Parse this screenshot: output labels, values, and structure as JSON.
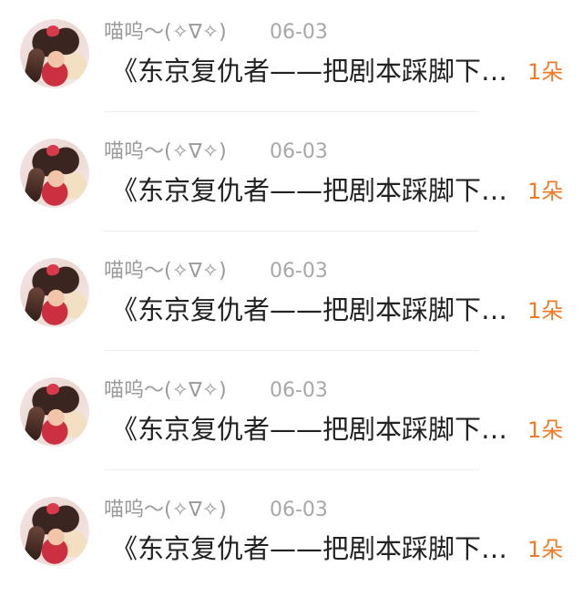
{
  "items": [
    {
      "author": "喵呜～(✧∇✧)",
      "date": "06-03",
      "title": "《东京复仇者——把剧本踩脚下…",
      "count": "1朵"
    },
    {
      "author": "喵呜～(✧∇✧)",
      "date": "06-03",
      "title": "《东京复仇者——把剧本踩脚下…",
      "count": "1朵"
    },
    {
      "author": "喵呜～(✧∇✧)",
      "date": "06-03",
      "title": "《东京复仇者——把剧本踩脚下…",
      "count": "1朵"
    },
    {
      "author": "喵呜～(✧∇✧)",
      "date": "06-03",
      "title": "《东京复仇者——把剧本踩脚下…",
      "count": "1朵"
    },
    {
      "author": "喵呜～(✧∇✧)",
      "date": "06-03",
      "title": "《东京复仇者——把剧本踩脚下…",
      "count": "1朵"
    }
  ]
}
